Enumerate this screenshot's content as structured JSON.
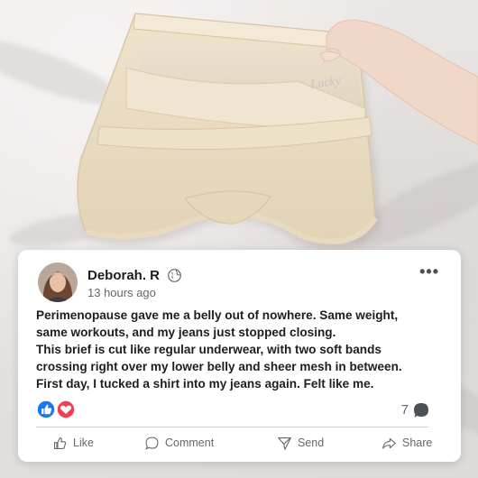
{
  "photo": {
    "product": "sheer mesh high-waist brief",
    "waistband_text": "Lucky"
  },
  "post": {
    "author": "Deborah. R",
    "timestamp": "13 hours ago",
    "privacy_icon": "globe-icon",
    "menu_icon": "more-dots-icon",
    "menu_glyph": "•••",
    "body_lines": [
      "Perimenopause gave me a belly out of nowhere. Same weight,",
      "same workouts, and my jeans just stopped closing.",
      "This brief is cut like regular underwear, with two soft bands",
      "crossing right over my lower belly and sheer mesh in between.",
      "First day, I tucked a shirt into my jeans again. Felt like me."
    ],
    "reactions": [
      "like",
      "love"
    ],
    "comment_count": "7",
    "actions": {
      "like": "Like",
      "comment": "Comment",
      "send": "Send",
      "share": "Share"
    }
  },
  "colors": {
    "like_blue": "#1877f2",
    "love_red": "#f33e58",
    "card_bg": "#ffffff",
    "fabric": "#efe3cc"
  }
}
